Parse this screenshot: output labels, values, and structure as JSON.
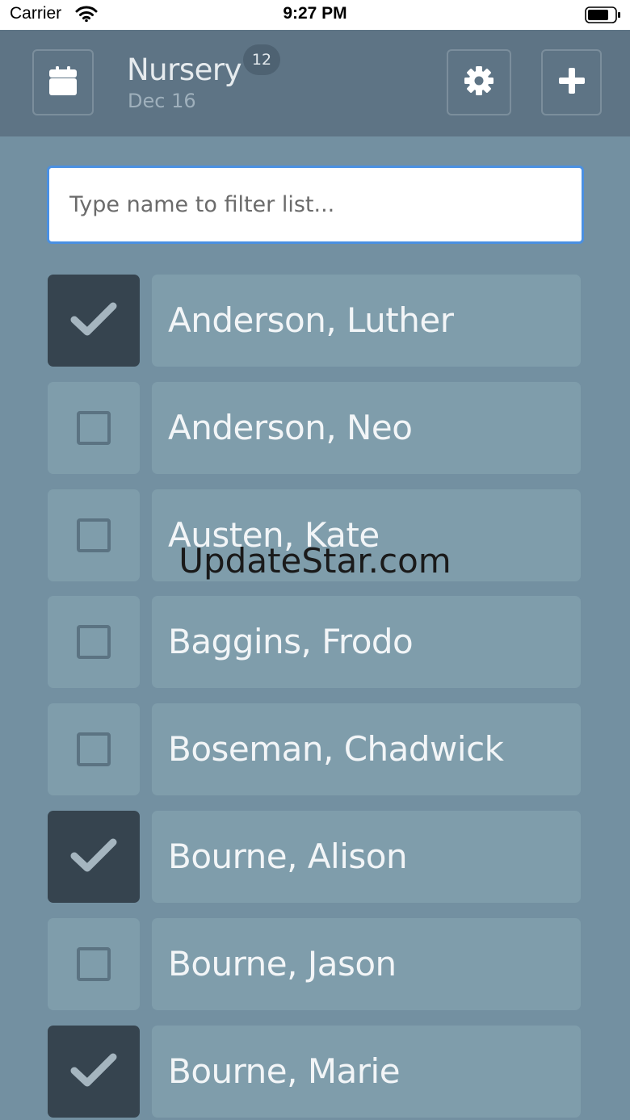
{
  "status_bar": {
    "carrier": "Carrier",
    "time": "9:27 PM"
  },
  "header": {
    "title": "Nursery",
    "count_badge": "12",
    "date": "Dec 16",
    "calendar_icon": "calendar-icon",
    "settings_icon": "gear-icon",
    "add_icon": "plus-icon"
  },
  "filter": {
    "placeholder": "Type name to filter list...",
    "value": ""
  },
  "people": [
    {
      "name": "Anderson, Luther",
      "checked": true
    },
    {
      "name": "Anderson, Neo",
      "checked": false
    },
    {
      "name": "Austen, Kate",
      "checked": false
    },
    {
      "name": "Baggins, Frodo",
      "checked": false
    },
    {
      "name": "Boseman, Chadwick",
      "checked": false
    },
    {
      "name": "Bourne, Alison",
      "checked": true
    },
    {
      "name": "Bourne, Jason",
      "checked": false
    },
    {
      "name": "Bourne, Marie",
      "checked": true
    }
  ],
  "watermark": "UpdateStar.com",
  "colors": {
    "background": "#7390a1",
    "header": "#5e7485",
    "checked": "#36444f",
    "unchecked": "#7f9dab",
    "focus": "#4a90e2"
  }
}
